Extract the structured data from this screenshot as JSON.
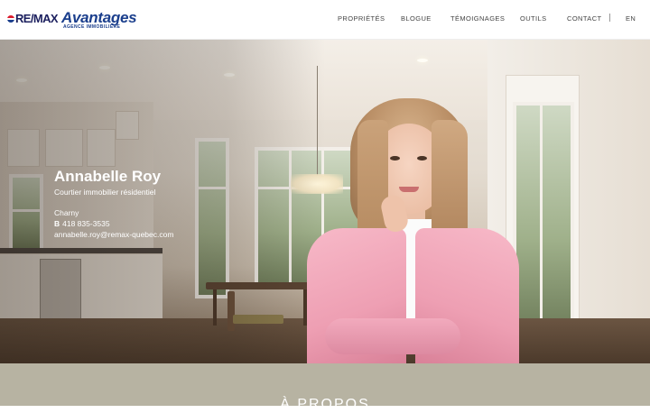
{
  "brand": {
    "remax": "RE/MAX",
    "name": "Avantages",
    "tagline": "AGENCE IMMOBILIÈRE",
    "colors": {
      "red": "#dc1c2e",
      "blue": "#1a3e8c"
    }
  },
  "nav": {
    "items": [
      "PROPRIÉTÉS",
      "BLOGUE",
      "TÉMOIGNAGES",
      "OUTILS",
      "CONTACT"
    ],
    "lang": "EN"
  },
  "agent": {
    "name": "Annabelle Roy",
    "title": "Courtier immobilier résidentiel",
    "city": "Charny",
    "phone_prefix": "B",
    "phone": "418 835-3535",
    "email": "annabelle.roy@remax-quebec.com"
  },
  "about": {
    "title": "À PROPOS",
    "background": "#b7b3a2"
  }
}
